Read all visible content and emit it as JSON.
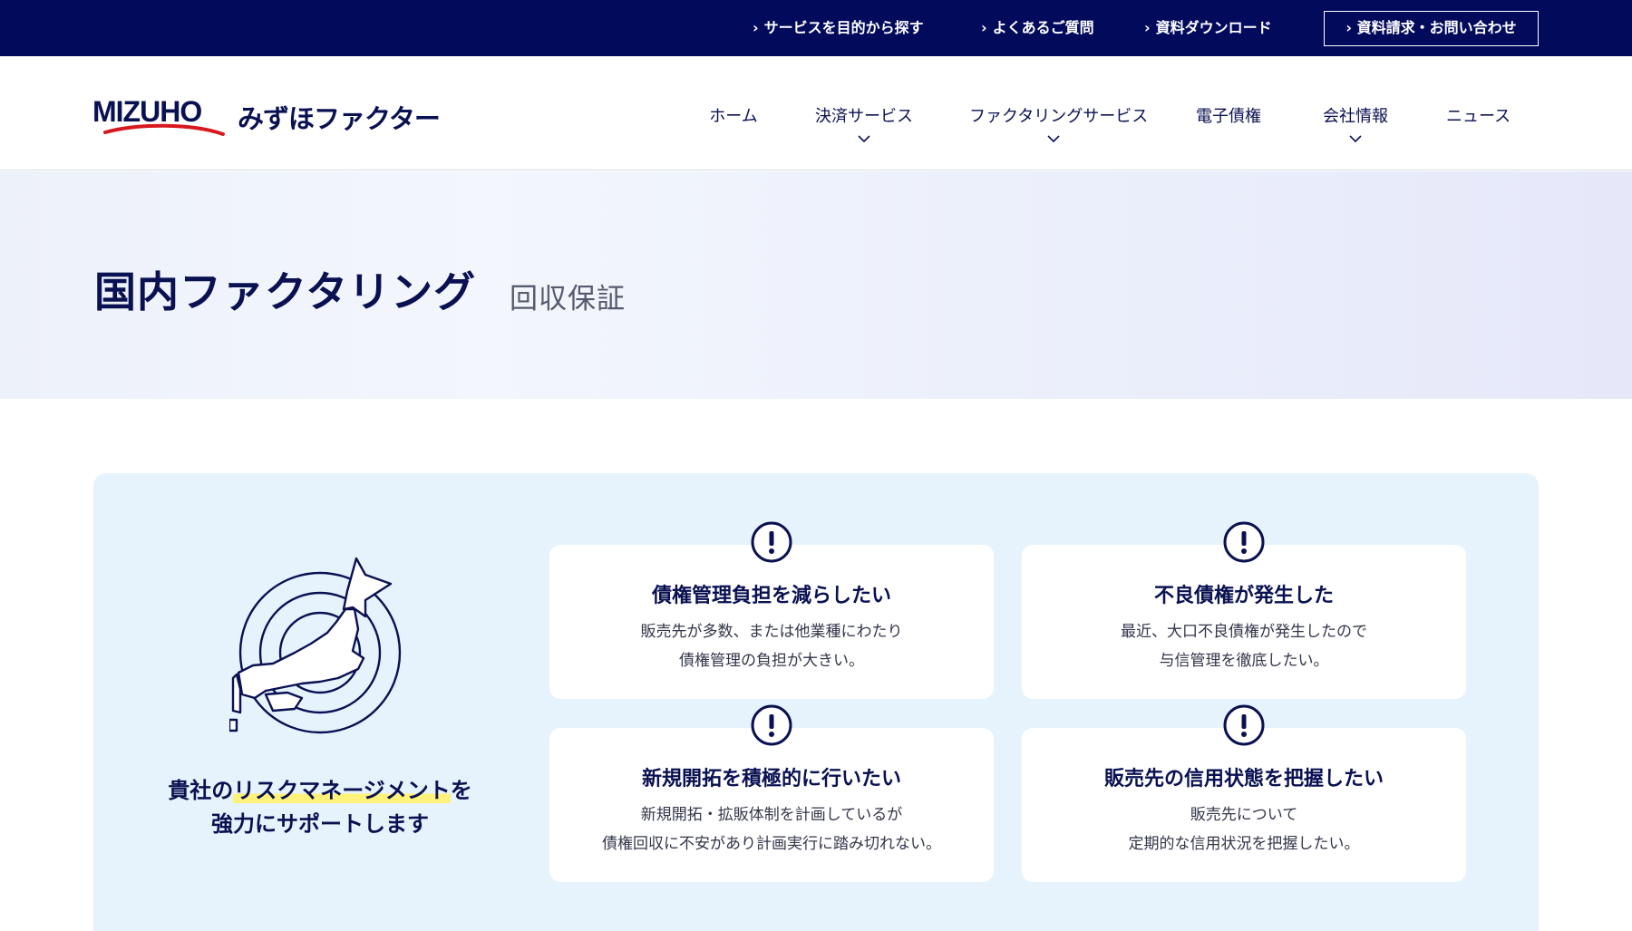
{
  "topbar": {
    "links": [
      {
        "label": "サービスを目的から探す"
      },
      {
        "label": "よくあるご質問"
      },
      {
        "label": "資料ダウンロード"
      }
    ],
    "cta_label": "資料請求・お問い合わせ"
  },
  "header": {
    "logo_mark_text": "MIZUHO",
    "logo_name": "みずほファクター",
    "nav": [
      {
        "label": "ホーム"
      },
      {
        "label": "決済サービス"
      },
      {
        "label": "ファクタリングサービス"
      },
      {
        "label": "電子債権"
      },
      {
        "label": "会社情報"
      },
      {
        "label": "ニュース"
      }
    ]
  },
  "hero": {
    "title": "国内ファクタリング",
    "subtitle": "回収保証"
  },
  "panel": {
    "tagline_pre": "貴社の",
    "tagline_highlight": "リスクマネージメント",
    "tagline_post": "を",
    "tagline_line2": "強力にサポートします",
    "cards": [
      {
        "title": "債権管理負担を減らしたい",
        "line1": "販売先が多数、または他業種にわたり",
        "line2": "債権管理の負担が大きい。"
      },
      {
        "title": "不良債権が発生した",
        "line1": "最近、大口不良債権が発生したので",
        "line2": "与信管理を徹底したい。"
      },
      {
        "title": "新規開拓を積極的に行いたい",
        "line1": "新規開拓・拡販体制を計画しているが",
        "line2": "債権回収に不安があり計画実行に踏み切れない。"
      },
      {
        "title": "販売先の信用状態を把握したい",
        "line1": "販売先について",
        "line2": "定期的な信用状況を把握したい。"
      }
    ]
  },
  "colors": {
    "navy": "#020a5c",
    "text_navy": "#0a1152",
    "logo_red": "#d7191f",
    "panel_bg": "#e6f3fd",
    "highlight": "#fff27a"
  },
  "icons": [
    "chevron-right-icon",
    "chevron-down-icon",
    "exclamation-circle-icon",
    "japan-target-illustration"
  ]
}
